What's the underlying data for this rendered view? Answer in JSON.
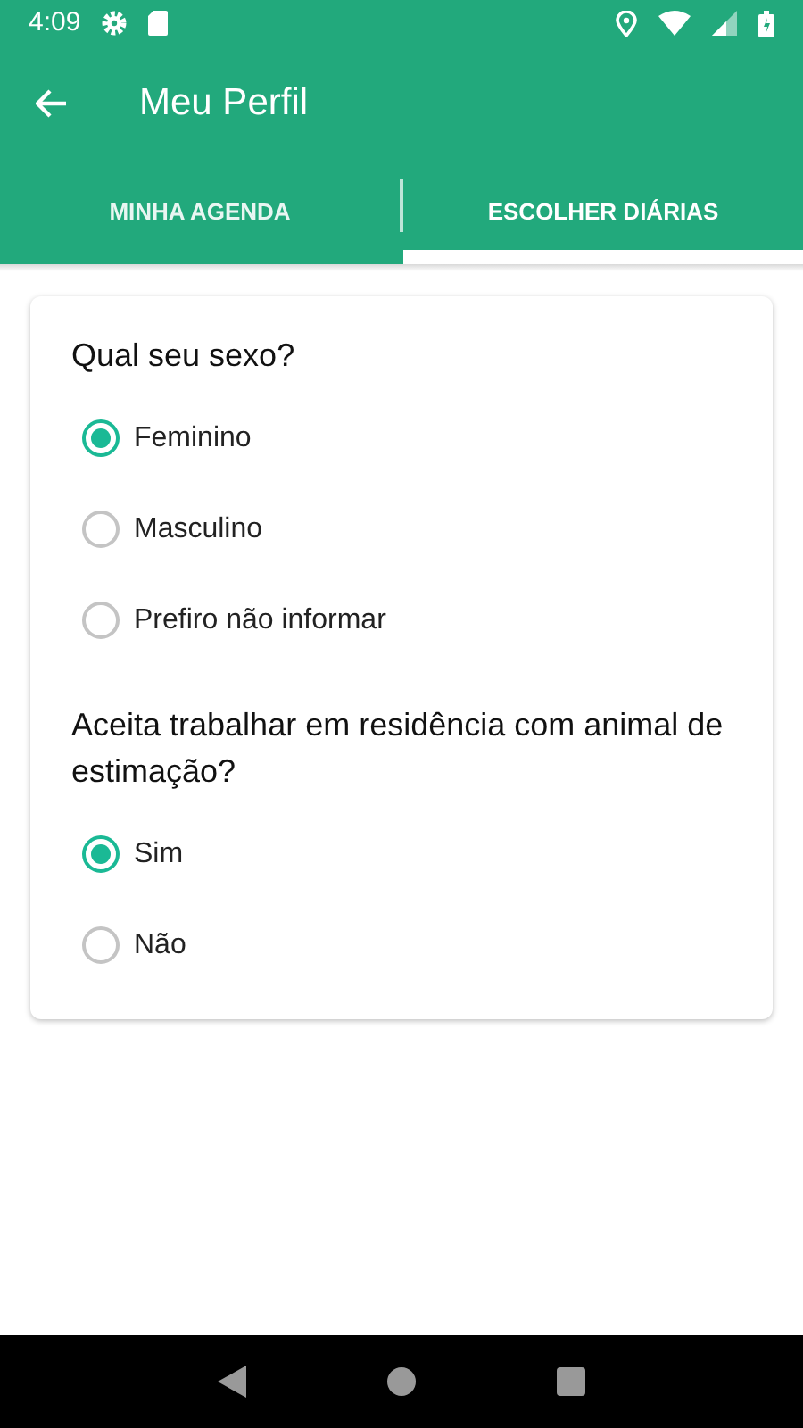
{
  "status_bar": {
    "time": "4:09"
  },
  "toolbar": {
    "title": "Meu Perfil"
  },
  "tabs": [
    {
      "label": "MINHA AGENDA",
      "selected": false
    },
    {
      "label": "ESCOLHER DIÁRIAS",
      "selected": true
    }
  ],
  "questions": [
    {
      "question": "Qual seu sexo?",
      "options": [
        {
          "label": "Feminino",
          "selected": true
        },
        {
          "label": "Masculino",
          "selected": false
        },
        {
          "label": "Prefiro não informar",
          "selected": false
        }
      ]
    },
    {
      "question": "Aceita trabalhar em residência com animal de estimação?",
      "options": [
        {
          "label": "Sim",
          "selected": true
        },
        {
          "label": "Não",
          "selected": false
        }
      ]
    }
  ]
}
